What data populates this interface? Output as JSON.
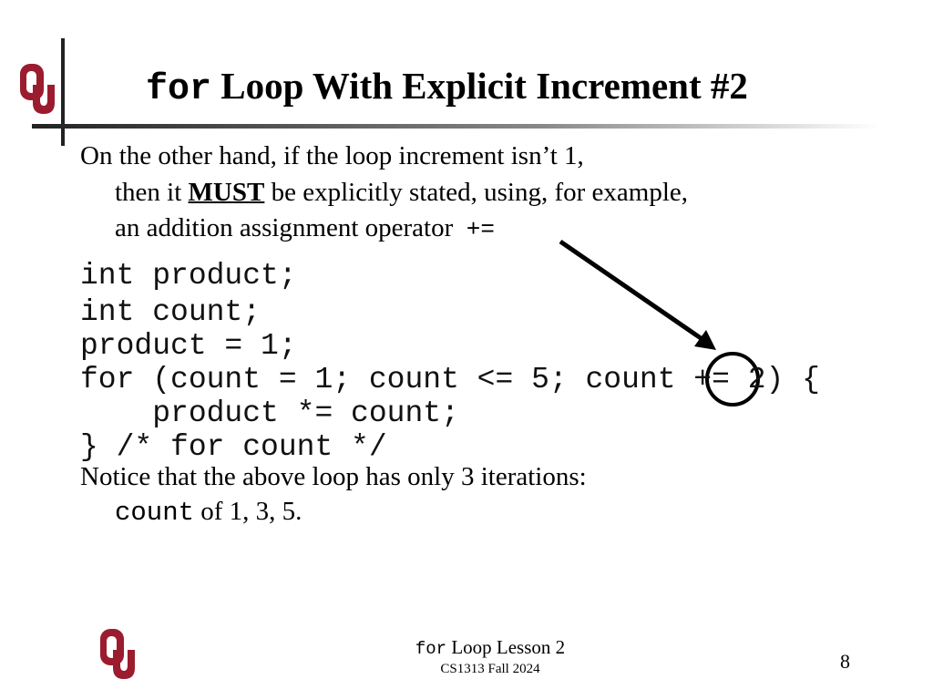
{
  "title": {
    "keyword": "for",
    "text": "Loop With Explicit Increment #2"
  },
  "body": {
    "line1": "On the other hand, if the loop increment isn’t 1,",
    "line2_pre": "then it ",
    "line2_emph": "MUST",
    "line2_post": " be explicitly stated, using, for example,",
    "line3": "an addition assignment operator",
    "line3_op": "+=",
    "code": [
      "int product;",
      "int count;",
      "product = 1;",
      "for (count = 1; count <= 5; count += 2) {",
      "    product *= count;",
      "} /* for count */"
    ],
    "notice": "Notice that the above loop has only 3 iterations:",
    "notice2_code": "count",
    "notice2_text": " of 1, 3, 5."
  },
  "footer": {
    "keyword": "for",
    "lesson": " Loop Lesson 2",
    "course": "CS1313 Fall 2024",
    "page": "8"
  },
  "colors": {
    "logo": "#9b1c2e",
    "annotation": "#000000"
  },
  "logo_text": "OU"
}
